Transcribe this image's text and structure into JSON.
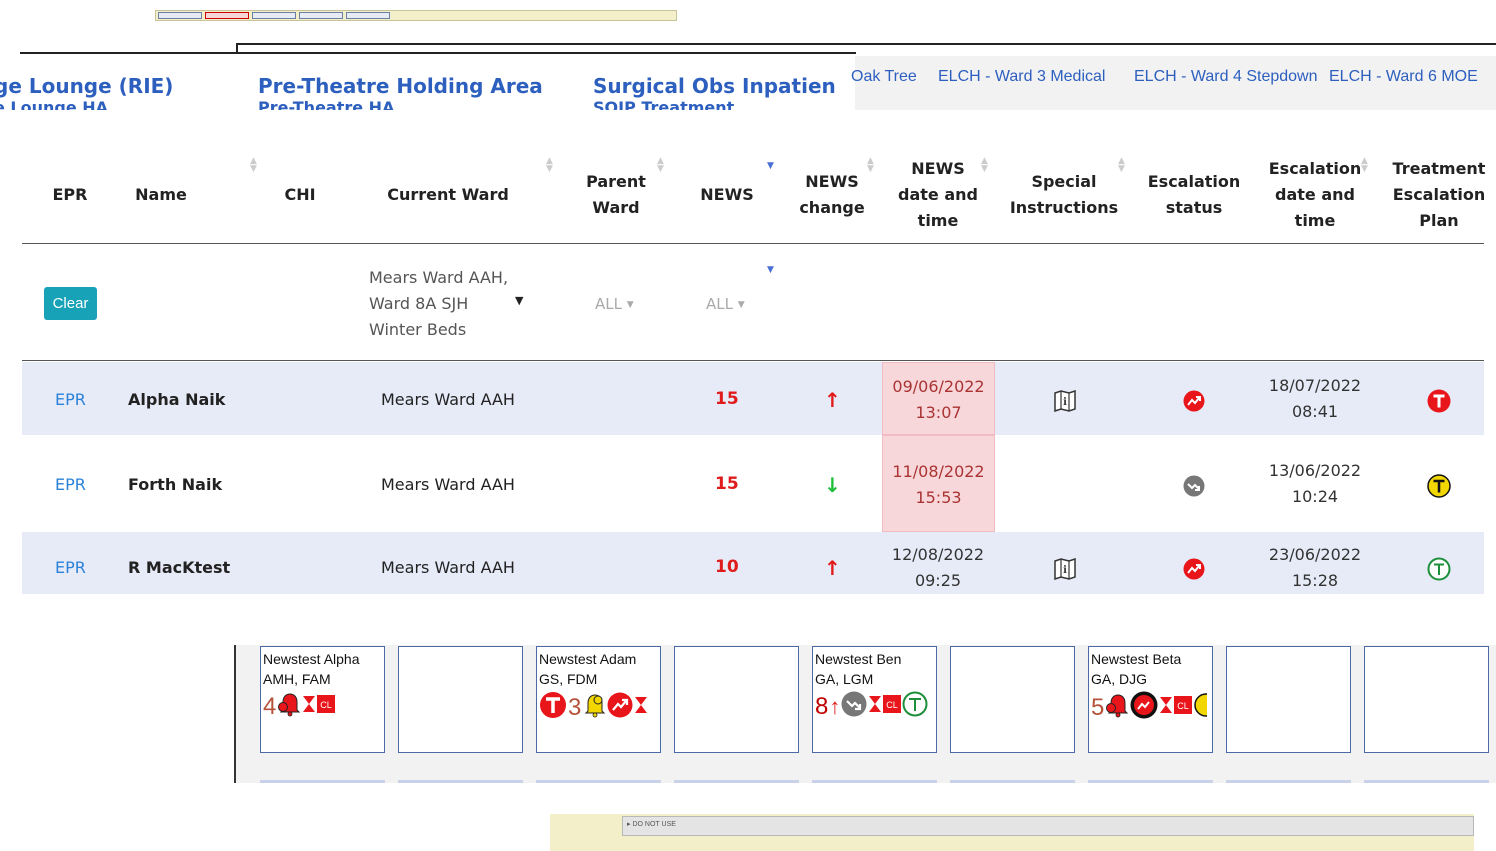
{
  "top_tabs": {
    "count": 5,
    "active_index": 1
  },
  "footer_strip": {
    "label": "DO NOT USE"
  },
  "wards_header": {
    "left": [
      {
        "title": "ge Lounge (RIE)",
        "sub": "e Lounge HA"
      },
      {
        "title": "Pre-Theatre Holding Area",
        "sub": "Pre-Theatre HA"
      },
      {
        "title": "Surgical Obs Inpatien",
        "sub": "SOIP Treatment"
      }
    ],
    "right": [
      "Oak Tree",
      "ELCH - Ward 3 Medical",
      "ELCH - Ward 4 Stepdown",
      "ELCH - Ward 6 MOE"
    ]
  },
  "table": {
    "headers": {
      "epr": "EPR",
      "name": "Name",
      "chi": "CHI",
      "current_ward": "Current Ward",
      "parent_ward_1": "Parent",
      "parent_ward_2": "Ward",
      "news": "NEWS",
      "news_change_1": "NEWS",
      "news_change_2": "change",
      "news_dt_1": "NEWS",
      "news_dt_2": "date and",
      "news_dt_3": "time",
      "special_1": "Special",
      "special_2": "Instructions",
      "esc_status_1": "Escalation",
      "esc_status_2": "status",
      "esc_dt_1": "Escalation",
      "esc_dt_2": "date and",
      "esc_dt_3": "time",
      "tep_1": "Treatment",
      "tep_2": "Escalation",
      "tep_3": "Plan"
    },
    "filters": {
      "clear_label": "Clear",
      "ward_line1": "Mears Ward AAH,",
      "ward_line2": "Ward 8A SJH",
      "ward_line3": "Winter Beds",
      "parent_ward": "ALL",
      "news": "ALL"
    },
    "rows": [
      {
        "epr": "EPR",
        "name": "Alpha Naik",
        "ward": "Mears Ward AAH",
        "news": "15",
        "change": "up",
        "news_date": "09/06/2022",
        "news_time": "13:07",
        "news_dt_overdue": true,
        "special": true,
        "escalation": "red-trend",
        "esc_date": "18/07/2022",
        "esc_time": "08:41",
        "tep": "red-T"
      },
      {
        "epr": "EPR",
        "name": "Forth Naik",
        "ward": "Mears Ward AAH",
        "news": "15",
        "change": "down",
        "news_date": "11/08/2022",
        "news_time": "15:53",
        "news_dt_overdue": true,
        "special": false,
        "escalation": "grey-trend",
        "esc_date": "13/06/2022",
        "esc_time": "10:24",
        "tep": "yellow-T"
      },
      {
        "epr": "EPR",
        "name": "R MacKtest",
        "ward": "Mears Ward AAH",
        "news": "10",
        "change": "up",
        "news_date": "12/08/2022",
        "news_time": "09:25",
        "news_dt_overdue": false,
        "special": true,
        "escalation": "red-trend",
        "esc_date": "23/06/2022",
        "esc_time": "15:28",
        "tep": "green-T"
      }
    ]
  },
  "cards": [
    {
      "name": "Newstest Alpha",
      "initials": "AMH, FAM",
      "score": "4",
      "score_color": "#b5523a"
    },
    {
      "name": "",
      "initials": "",
      "score": ""
    },
    {
      "name": "Newstest Adam",
      "initials": "GS, FDM",
      "score": "3",
      "score_color": "#b5523a"
    },
    {
      "name": "",
      "initials": "",
      "score": ""
    },
    {
      "name": "Newstest Ben",
      "initials": "GA, LGM",
      "score": "8",
      "score_color": "#c00000"
    },
    {
      "name": "",
      "initials": "",
      "score": ""
    },
    {
      "name": "Newstest Beta",
      "initials": "GA, DJG",
      "score": "5",
      "score_color": "#b5523a"
    },
    {
      "name": "",
      "initials": "",
      "score": ""
    },
    {
      "name": "",
      "initials": "",
      "score": ""
    }
  ],
  "colors": {
    "link": "#2a82d8",
    "news_red": "#e01b1b",
    "clear_button": "#17a2b8",
    "overdue_bg": "#f8d7da"
  }
}
